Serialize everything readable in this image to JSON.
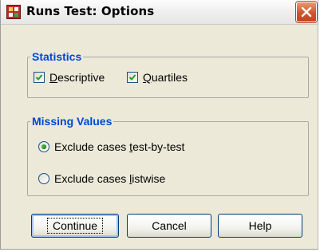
{
  "dialog": {
    "title": "Runs Test: Options",
    "icon": "app-grid-icon",
    "close_icon": "close-icon"
  },
  "statistics": {
    "legend": "Statistics",
    "descriptive": {
      "label_prefix": "",
      "accel": "D",
      "label_rest": "escriptive",
      "checked": true
    },
    "quartiles": {
      "label_prefix": "",
      "accel": "Q",
      "label_rest": "uartiles",
      "checked": true
    }
  },
  "missing_values": {
    "legend": "Missing Values",
    "options": [
      {
        "label_prefix": "Exclude cases ",
        "accel": "t",
        "label_rest": "est-by-test",
        "selected": true
      },
      {
        "label_prefix": "Exclude cases ",
        "accel": "l",
        "label_rest": "istwise",
        "selected": false
      }
    ]
  },
  "buttons": {
    "continue": "Continue",
    "cancel": "Cancel",
    "help": "Help"
  },
  "colors": {
    "legend": "#0046d5",
    "close_button": "#d2552d",
    "window_bg": "#ece9d8"
  }
}
